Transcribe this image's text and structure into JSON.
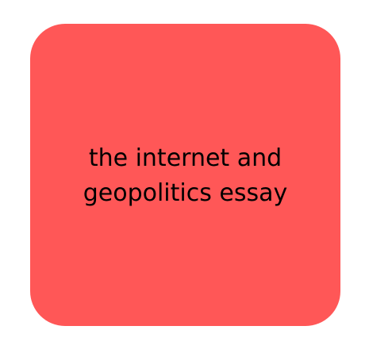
{
  "card": {
    "background_color": "#ff5757",
    "line1": "the internet and",
    "line2": "geopolitics essay"
  }
}
